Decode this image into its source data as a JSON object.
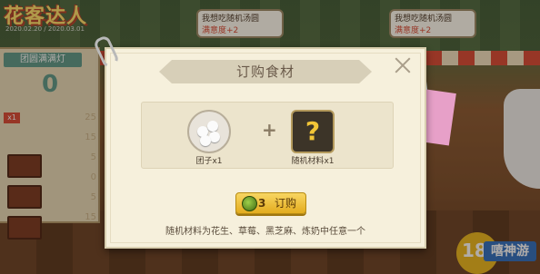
{
  "game": {
    "logo": "花客达人",
    "logo_sub": "2020.02.20 / 2020.03.01",
    "left_panel": {
      "header": "团圆满满灯",
      "count": "0",
      "badge": "x1",
      "ruler_ticks": [
        "25",
        "15",
        "5",
        "0",
        "5",
        "15"
      ]
    },
    "bubbles": [
      {
        "text": "我想吃随机汤圆",
        "highlight": "满意度+2"
      },
      {
        "text": "我想吃随机汤圆",
        "highlight": "满意度+2"
      }
    ],
    "corner_logo": {
      "number": "188",
      "word": "嘻神游"
    }
  },
  "dialog": {
    "title": "订购食材",
    "items": [
      {
        "icon": "tuanzi-icon",
        "label": "团子x1"
      },
      {
        "icon": "random-ingredient-icon",
        "label": "随机材料x1",
        "symbol": "?"
      }
    ],
    "plus": "+",
    "buy_button": {
      "cost": "3",
      "label": "订购",
      "coin_color": "#6aa82a"
    },
    "hint": "随机材料为花生、草莓、黑芝麻、炼奶中任意一个"
  },
  "colors": {
    "dialog_bg": "#f6f0dc",
    "button_gold": "#f2c537",
    "accent_red": "#d94a36"
  }
}
